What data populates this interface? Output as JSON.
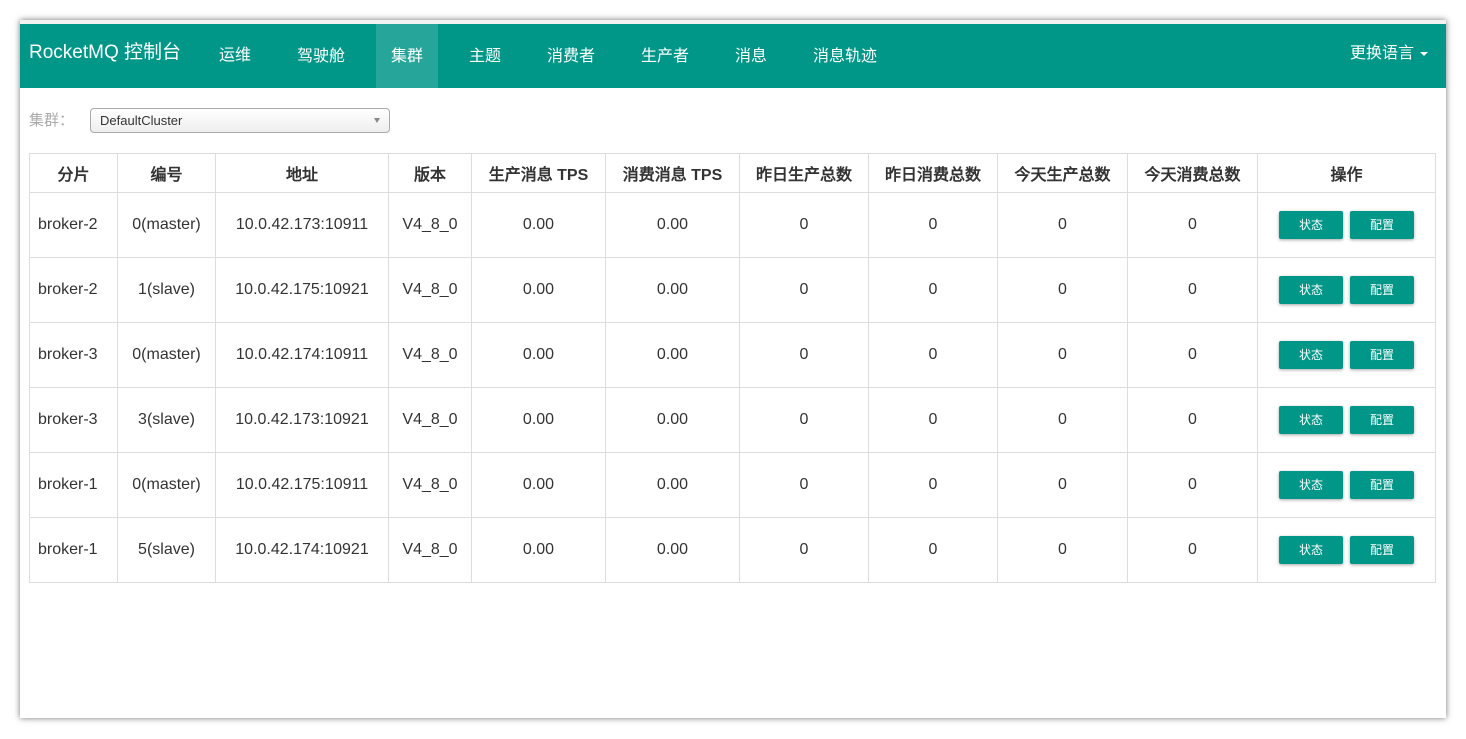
{
  "navbar": {
    "brand": "RocketMQ 控制台",
    "items": [
      {
        "label": "运维"
      },
      {
        "label": "驾驶舱"
      },
      {
        "label": "集群"
      },
      {
        "label": "主题"
      },
      {
        "label": "消费者"
      },
      {
        "label": "生产者"
      },
      {
        "label": "消息"
      },
      {
        "label": "消息轨迹"
      }
    ],
    "active": "集群",
    "lang_label": "更换语言"
  },
  "filter": {
    "label": "集群：",
    "selected": "DefaultCluster"
  },
  "table": {
    "headers": [
      "分片",
      "编号",
      "地址",
      "版本",
      "生产消息 TPS",
      "消费消息 TPS",
      "昨日生产总数",
      "昨日消费总数",
      "今天生产总数",
      "今天消费总数",
      "操作"
    ],
    "rows": [
      [
        "broker-2",
        "0(master)",
        "10.0.42.173:10911",
        "V4_8_0",
        "0.00",
        "0.00",
        "0",
        "0",
        "0",
        "0"
      ],
      [
        "broker-2",
        "1(slave)",
        "10.0.42.175:10921",
        "V4_8_0",
        "0.00",
        "0.00",
        "0",
        "0",
        "0",
        "0"
      ],
      [
        "broker-3",
        "0(master)",
        "10.0.42.174:10911",
        "V4_8_0",
        "0.00",
        "0.00",
        "0",
        "0",
        "0",
        "0"
      ],
      [
        "broker-3",
        "3(slave)",
        "10.0.42.173:10921",
        "V4_8_0",
        "0.00",
        "0.00",
        "0",
        "0",
        "0",
        "0"
      ],
      [
        "broker-1",
        "0(master)",
        "10.0.42.175:10911",
        "V4_8_0",
        "0.00",
        "0.00",
        "0",
        "0",
        "0",
        "0"
      ],
      [
        "broker-1",
        "5(slave)",
        "10.0.42.174:10921",
        "V4_8_0",
        "0.00",
        "0.00",
        "0",
        "0",
        "0",
        "0"
      ]
    ],
    "actions": {
      "status_label": "状态",
      "config_label": "配置"
    }
  },
  "colors": {
    "primary": "#009688",
    "nav_active": "#26a69a"
  }
}
